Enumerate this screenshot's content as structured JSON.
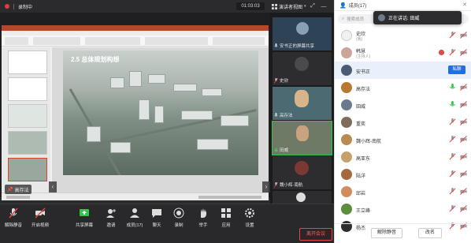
{
  "top": {
    "recording_label": "录制中",
    "timer": "01:03:03",
    "view_mode": "演讲者视图"
  },
  "share": {
    "slide_heading": "2.5 总体规划构想",
    "pinned_label": "固定",
    "pinned_name": "高存法"
  },
  "videos": [
    {
      "name": "安书正的屏幕共享",
      "muted": false
    },
    {
      "name": "史欣",
      "muted": true
    },
    {
      "name": "高存法",
      "muted": false
    },
    {
      "name": "田威",
      "muted": false,
      "active": true
    },
    {
      "name": "魏小辉-南航",
      "muted": true
    },
    {
      "name": "重奕",
      "muted": true
    }
  ],
  "toolbar": {
    "mute_all": "解除静音",
    "start_video": "开启视频",
    "share_screen": "共享屏幕",
    "invite": "邀请",
    "participants": "成员(17)",
    "chat": "聊天",
    "record": "录制",
    "raise_hand": "举手",
    "apps": "应用",
    "settings": "设置",
    "leave": "离开会议"
  },
  "panel": {
    "title": "成员(17)",
    "speaking_label": "正在讲话: 田威",
    "search_placeholder": "搜索成员",
    "members": [
      {
        "name": "史欣",
        "sub": "(我)",
        "avatar": "#f1f1f1"
      },
      {
        "name": "韩慧",
        "sub": "(主持人)",
        "avatar": "#c9a59a",
        "recording": true
      },
      {
        "name": "安书正",
        "sub": "",
        "avatar": "#4a5c74",
        "selected": true,
        "chat": "私聊"
      },
      {
        "name": "高存法",
        "sub": "",
        "avatar": "#b7782f",
        "mic_on": true
      },
      {
        "name": "田威",
        "sub": "",
        "avatar": "#6a7a8a",
        "mic_on": true
      },
      {
        "name": "重奕",
        "sub": "",
        "avatar": "#7d6c5a"
      },
      {
        "name": "魏小辉-南航",
        "sub": "",
        "avatar": "#b98b52"
      },
      {
        "name": "高亚东",
        "sub": "",
        "avatar": "#c7a06a"
      },
      {
        "name": "陆洋",
        "sub": "",
        "avatar": "#a56b3f"
      },
      {
        "name": "邱岩",
        "sub": "",
        "avatar": "#d38c5b"
      },
      {
        "name": "王立峰",
        "sub": "",
        "avatar": "#5b8f3c"
      },
      {
        "name": "杨杰",
        "sub": "",
        "avatar": "#2e2e2e"
      }
    ],
    "unmute_all": "解除静音",
    "rename": "改名"
  },
  "colors": {
    "accent": "#1e6fe8",
    "danger": "#e04a4a",
    "speaking": "#35c34a"
  }
}
